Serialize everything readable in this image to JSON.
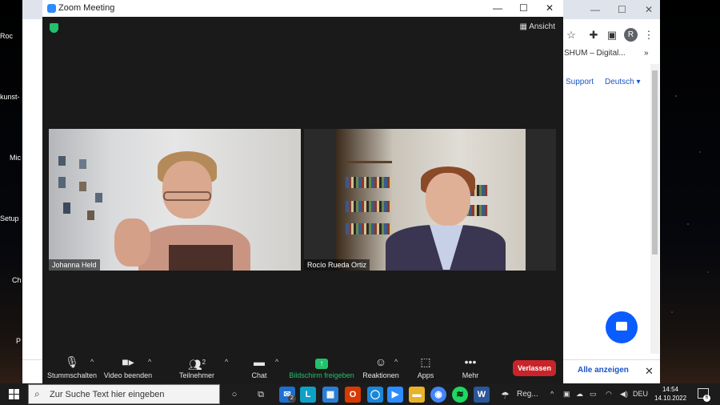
{
  "desktop": {
    "icons": [
      "Roc",
      "kunst-",
      "Mic",
      "Setup",
      "Ch",
      "P"
    ]
  },
  "browser": {
    "bookmark": "SHUM – Digital...",
    "more_bookmarks": "»",
    "avatar_letter": "R",
    "links": {
      "support": "Support",
      "language": "Deutsch"
    },
    "download_bar": {
      "show_all": "Alle anzeigen",
      "close": "✕"
    }
  },
  "zoom": {
    "title": "Zoom Meeting",
    "view_label": "Ansicht",
    "participants": [
      {
        "name": "Johanna Held"
      },
      {
        "name": "Rocío Rueda Ortiz"
      }
    ],
    "toolbar": {
      "mute": "Stummschalten",
      "video": "Video beenden",
      "participants": "Teilnehmer",
      "participants_count": "2",
      "chat": "Chat",
      "share": "Bildschirm freigeben",
      "reactions": "Reaktionen",
      "apps": "Apps",
      "more": "Mehr",
      "leave": "Verlassen"
    }
  },
  "taskbar": {
    "search_placeholder": "Zur Suche Text hier eingeben",
    "mail_badge": "2",
    "weather_label": "Reg...",
    "language": "DEU",
    "time": "14:54",
    "date": "14.10.2022",
    "notifications": "6"
  }
}
